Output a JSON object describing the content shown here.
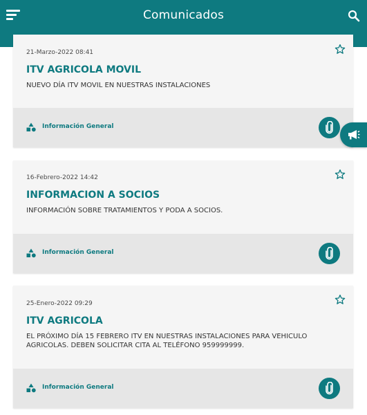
{
  "appbar": {
    "title": "Comunicados",
    "menu_icon": "hamburger-menu-icon",
    "search_icon": "search-icon"
  },
  "colors": {
    "primary": "#0e7a80",
    "card_background": "#f5f5f5",
    "card_footer": "#e6e6e6"
  },
  "announcements": [
    {
      "date": "21-Marzo-2022 08:41",
      "title": "ITV AGRICOLA MOVIL",
      "body": "NUEVO DÍA ITV MOVIL EN NUESTRAS INSTALACIONES",
      "category": "Información General",
      "category_icon": "shapes-category-icon",
      "favorite_icon": "star-outline-icon",
      "attachment_icon": "paperclip-icon"
    },
    {
      "date": "16-Febrero-2022 14:42",
      "title": "INFORMACION A SOCIOS",
      "body": "INFORMACIÓN SOBRE TRATAMIENTOS Y PODA A SOCIOS.",
      "category": "Información General",
      "category_icon": "shapes-category-icon",
      "favorite_icon": "star-outline-icon",
      "attachment_icon": "paperclip-icon"
    },
    {
      "date": "25-Enero-2022 09:29",
      "title": "ITV AGRICOLA",
      "body": "EL PRÓXIMO DÍA 15 FEBRERO ITV EN NUESTRAS INSTALACIONES PARA VEHICULO AGRICOLAS. DEBEN SOLICITAR CITA AL TELÉFONO 959999999.",
      "category": "Información General",
      "category_icon": "shapes-category-icon",
      "favorite_icon": "star-outline-icon",
      "attachment_icon": "paperclip-icon"
    }
  ],
  "floating_button": {
    "icon": "megaphone-icon"
  }
}
